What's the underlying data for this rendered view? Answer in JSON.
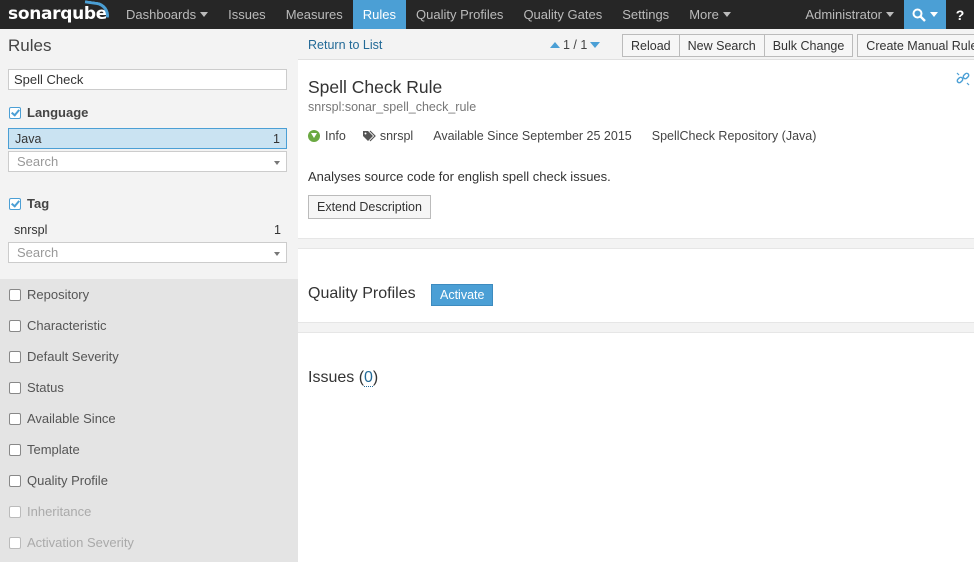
{
  "nav": {
    "logo": "sonarqube",
    "items": [
      {
        "label": "Dashboards",
        "caret": true
      },
      {
        "label": "Issues"
      },
      {
        "label": "Measures"
      },
      {
        "label": "Rules",
        "active": true
      },
      {
        "label": "Quality Profiles"
      },
      {
        "label": "Quality Gates"
      },
      {
        "label": "Settings"
      },
      {
        "label": "More",
        "caret": true
      }
    ],
    "user": "Administrator",
    "search_icon": "search-icon",
    "help": "?"
  },
  "sidebar": {
    "title": "Rules",
    "search_value": "Spell Check",
    "language": {
      "label": "Language",
      "selected_name": "Java",
      "selected_count": "1",
      "search_placeholder": "Search"
    },
    "tag": {
      "label": "Tag",
      "value_name": "snrspl",
      "value_count": "1",
      "search_placeholder": "Search"
    },
    "closed_facets": [
      "Repository",
      "Characteristic",
      "Default Severity",
      "Status",
      "Available Since",
      "Template",
      "Quality Profile",
      "Inheritance",
      "Activation Severity"
    ]
  },
  "toolbar": {
    "return_label": "Return to List",
    "pager": "1 / 1",
    "buttons": {
      "reload": "Reload",
      "new_search": "New Search",
      "bulk_change": "Bulk Change",
      "create_manual": "Create Manual Rule"
    }
  },
  "rule": {
    "title": "Spell Check Rule",
    "key": "snrspl:sonar_spell_check_rule",
    "severity": "Info",
    "tag": "snrspl",
    "available_since": "Available Since September 25 2015",
    "repository": "SpellCheck Repository (Java)",
    "description": "Analyses source code for english spell check issues.",
    "extend_label": "Extend Description"
  },
  "quality_profiles": {
    "title": "Quality Profiles",
    "activate_label": "Activate"
  },
  "issues": {
    "prefix": "Issues (",
    "count": "0",
    "suffix": ")"
  },
  "colors": {
    "accent": "#4b9fd5",
    "nav_bg": "#262626",
    "info_severity": "#6ba942",
    "link": "#236a97"
  }
}
